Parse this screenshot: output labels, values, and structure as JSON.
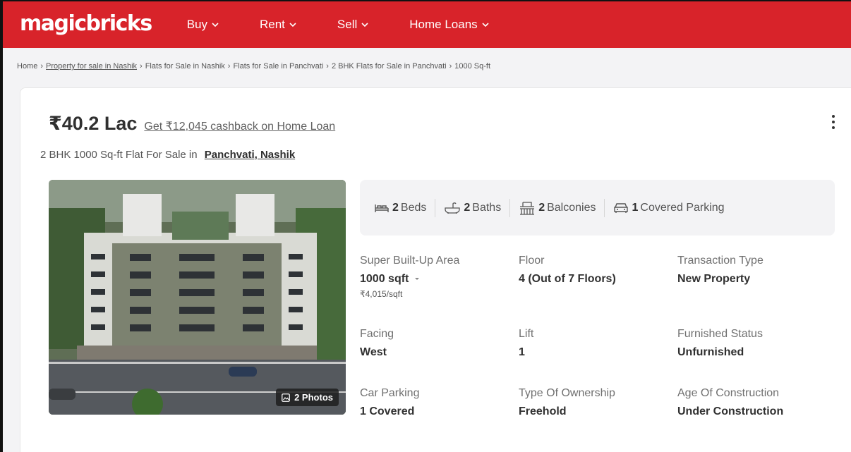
{
  "nav": {
    "logo": "magicbricks",
    "items": [
      {
        "label": "Buy"
      },
      {
        "label": "Rent"
      },
      {
        "label": "Sell"
      },
      {
        "label": "Home Loans"
      }
    ]
  },
  "breadcrumb": [
    {
      "label": "Home",
      "link": false
    },
    {
      "label": "Property for sale in Nashik",
      "link": true
    },
    {
      "label": "Flats for Sale in Nashik",
      "link": false
    },
    {
      "label": "Flats for Sale in Panchvati",
      "link": false
    },
    {
      "label": "2 BHK Flats for Sale in Panchvati",
      "link": false
    },
    {
      "label": "1000 Sq-ft",
      "link": false
    }
  ],
  "listing": {
    "price": "₹40.2 Lac",
    "cashback": "Get ₹12,045 cashback on Home Loan",
    "title_prefix": "2 BHK 1000 Sq-ft Flat For Sale in",
    "location": "Panchvati, Nashik",
    "photos_label": "2 Photos"
  },
  "summary": [
    {
      "icon": "bed-icon",
      "count": "2",
      "label": "Beds"
    },
    {
      "icon": "bathtub-icon",
      "count": "2",
      "label": "Baths"
    },
    {
      "icon": "balcony-icon",
      "count": "2",
      "label": "Balconies"
    },
    {
      "icon": "car-icon",
      "count": "1",
      "label": "Covered Parking"
    }
  ],
  "specs": {
    "area": {
      "label": "Super Built-Up Area",
      "value": "1000 sqft",
      "sub": "₹4,015/sqft"
    },
    "floor": {
      "label": "Floor",
      "value": "4 (Out of 7 Floors)"
    },
    "transaction": {
      "label": "Transaction Type",
      "value": "New Property"
    },
    "facing": {
      "label": "Facing",
      "value": "West"
    },
    "lift": {
      "label": "Lift",
      "value": "1"
    },
    "furnished": {
      "label": "Furnished Status",
      "value": "Unfurnished"
    },
    "parking": {
      "label": "Car Parking",
      "value": "1 Covered"
    },
    "ownership": {
      "label": "Type Of Ownership",
      "value": "Freehold"
    },
    "age": {
      "label": "Age Of Construction",
      "value": "Under Construction"
    }
  },
  "colors": {
    "brand": "#d8232a",
    "text": "#303030"
  }
}
